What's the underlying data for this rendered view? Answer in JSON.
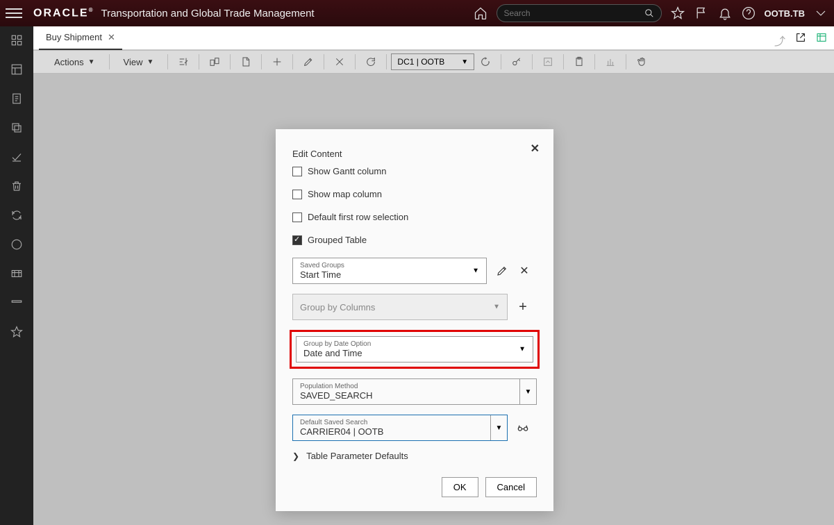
{
  "header": {
    "app_title": "Transportation and Global Trade Management",
    "search_placeholder": "Search",
    "user_label": "OOTB.TB"
  },
  "tab": {
    "title": "Buy Shipment"
  },
  "toolbar": {
    "actions_label": "Actions",
    "view_label": "View",
    "domain_select": "DC1 | OOTB"
  },
  "modal": {
    "title": "Edit Content",
    "show_gantt": "Show Gantt column",
    "show_map": "Show map column",
    "default_first_row": "Default first row selection",
    "grouped_table": "Grouped Table",
    "saved_groups": {
      "label": "Saved Groups",
      "value": "Start Time"
    },
    "group_by_columns": "Group by Columns",
    "group_by_date": {
      "label": "Group by Date Option",
      "value": "Date and Time"
    },
    "population_method": {
      "label": "Population Method",
      "value": "SAVED_SEARCH"
    },
    "default_saved_search": {
      "label": "Default Saved Search",
      "value": "CARRIER04 | OOTB"
    },
    "table_param_defaults": "Table Parameter Defaults",
    "ok": "OK",
    "cancel": "Cancel"
  }
}
